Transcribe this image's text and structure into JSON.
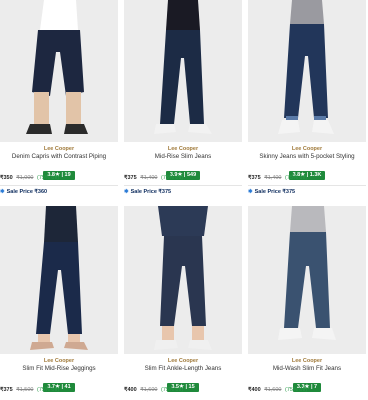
{
  "products": [
    {
      "brand": "Lee Cooper",
      "title": "Denim Capris with Contrast Piping",
      "rating": "3.8★ | 19",
      "price": "₹350",
      "mrp": "₹1,000",
      "discount": "(75% off)",
      "sale_label": "Sale Price ₹360",
      "denim_color": "#1d2740"
    },
    {
      "brand": "Lee Cooper",
      "title": "Mid-Rise Slim Jeans",
      "rating": "3.9★ | 549",
      "price": "₹375",
      "mrp": "₹1,400",
      "discount": "(75% off)",
      "sale_label": "Sale Price ₹375",
      "denim_color": "#1c2b45"
    },
    {
      "brand": "Lee Cooper",
      "title": "Skinny Jeans with 5-pocket Styling",
      "rating": "3.8★ | 1.3K",
      "price": "₹375",
      "mrp": "₹1,400",
      "discount": "(75% off)",
      "sale_label": "Sale Price ₹375",
      "denim_color": "#22365a"
    },
    {
      "brand": "Lee Cooper",
      "title": "Slim Fit Mid-Rise Jeggings",
      "rating": "3.7★ | 41",
      "price": "₹375",
      "mrp": "₹1,500",
      "discount": "(75% off)",
      "denim_color": "#1b2a4a"
    },
    {
      "brand": "Lee Cooper",
      "title": "Slim Fit Ankle-Length Jeans",
      "rating": "3.5★ | 15",
      "price": "₹400",
      "mrp": "₹1,600",
      "discount": "(75% off)",
      "denim_color": "#2a3650"
    },
    {
      "brand": "Lee Cooper",
      "title": "Mid-Wash Slim Fit Jeans",
      "rating": "3.3★ | 7",
      "price": "₹400",
      "mrp": "₹1,600",
      "discount": "(75% off)",
      "denim_color": "#3a5270"
    }
  ]
}
